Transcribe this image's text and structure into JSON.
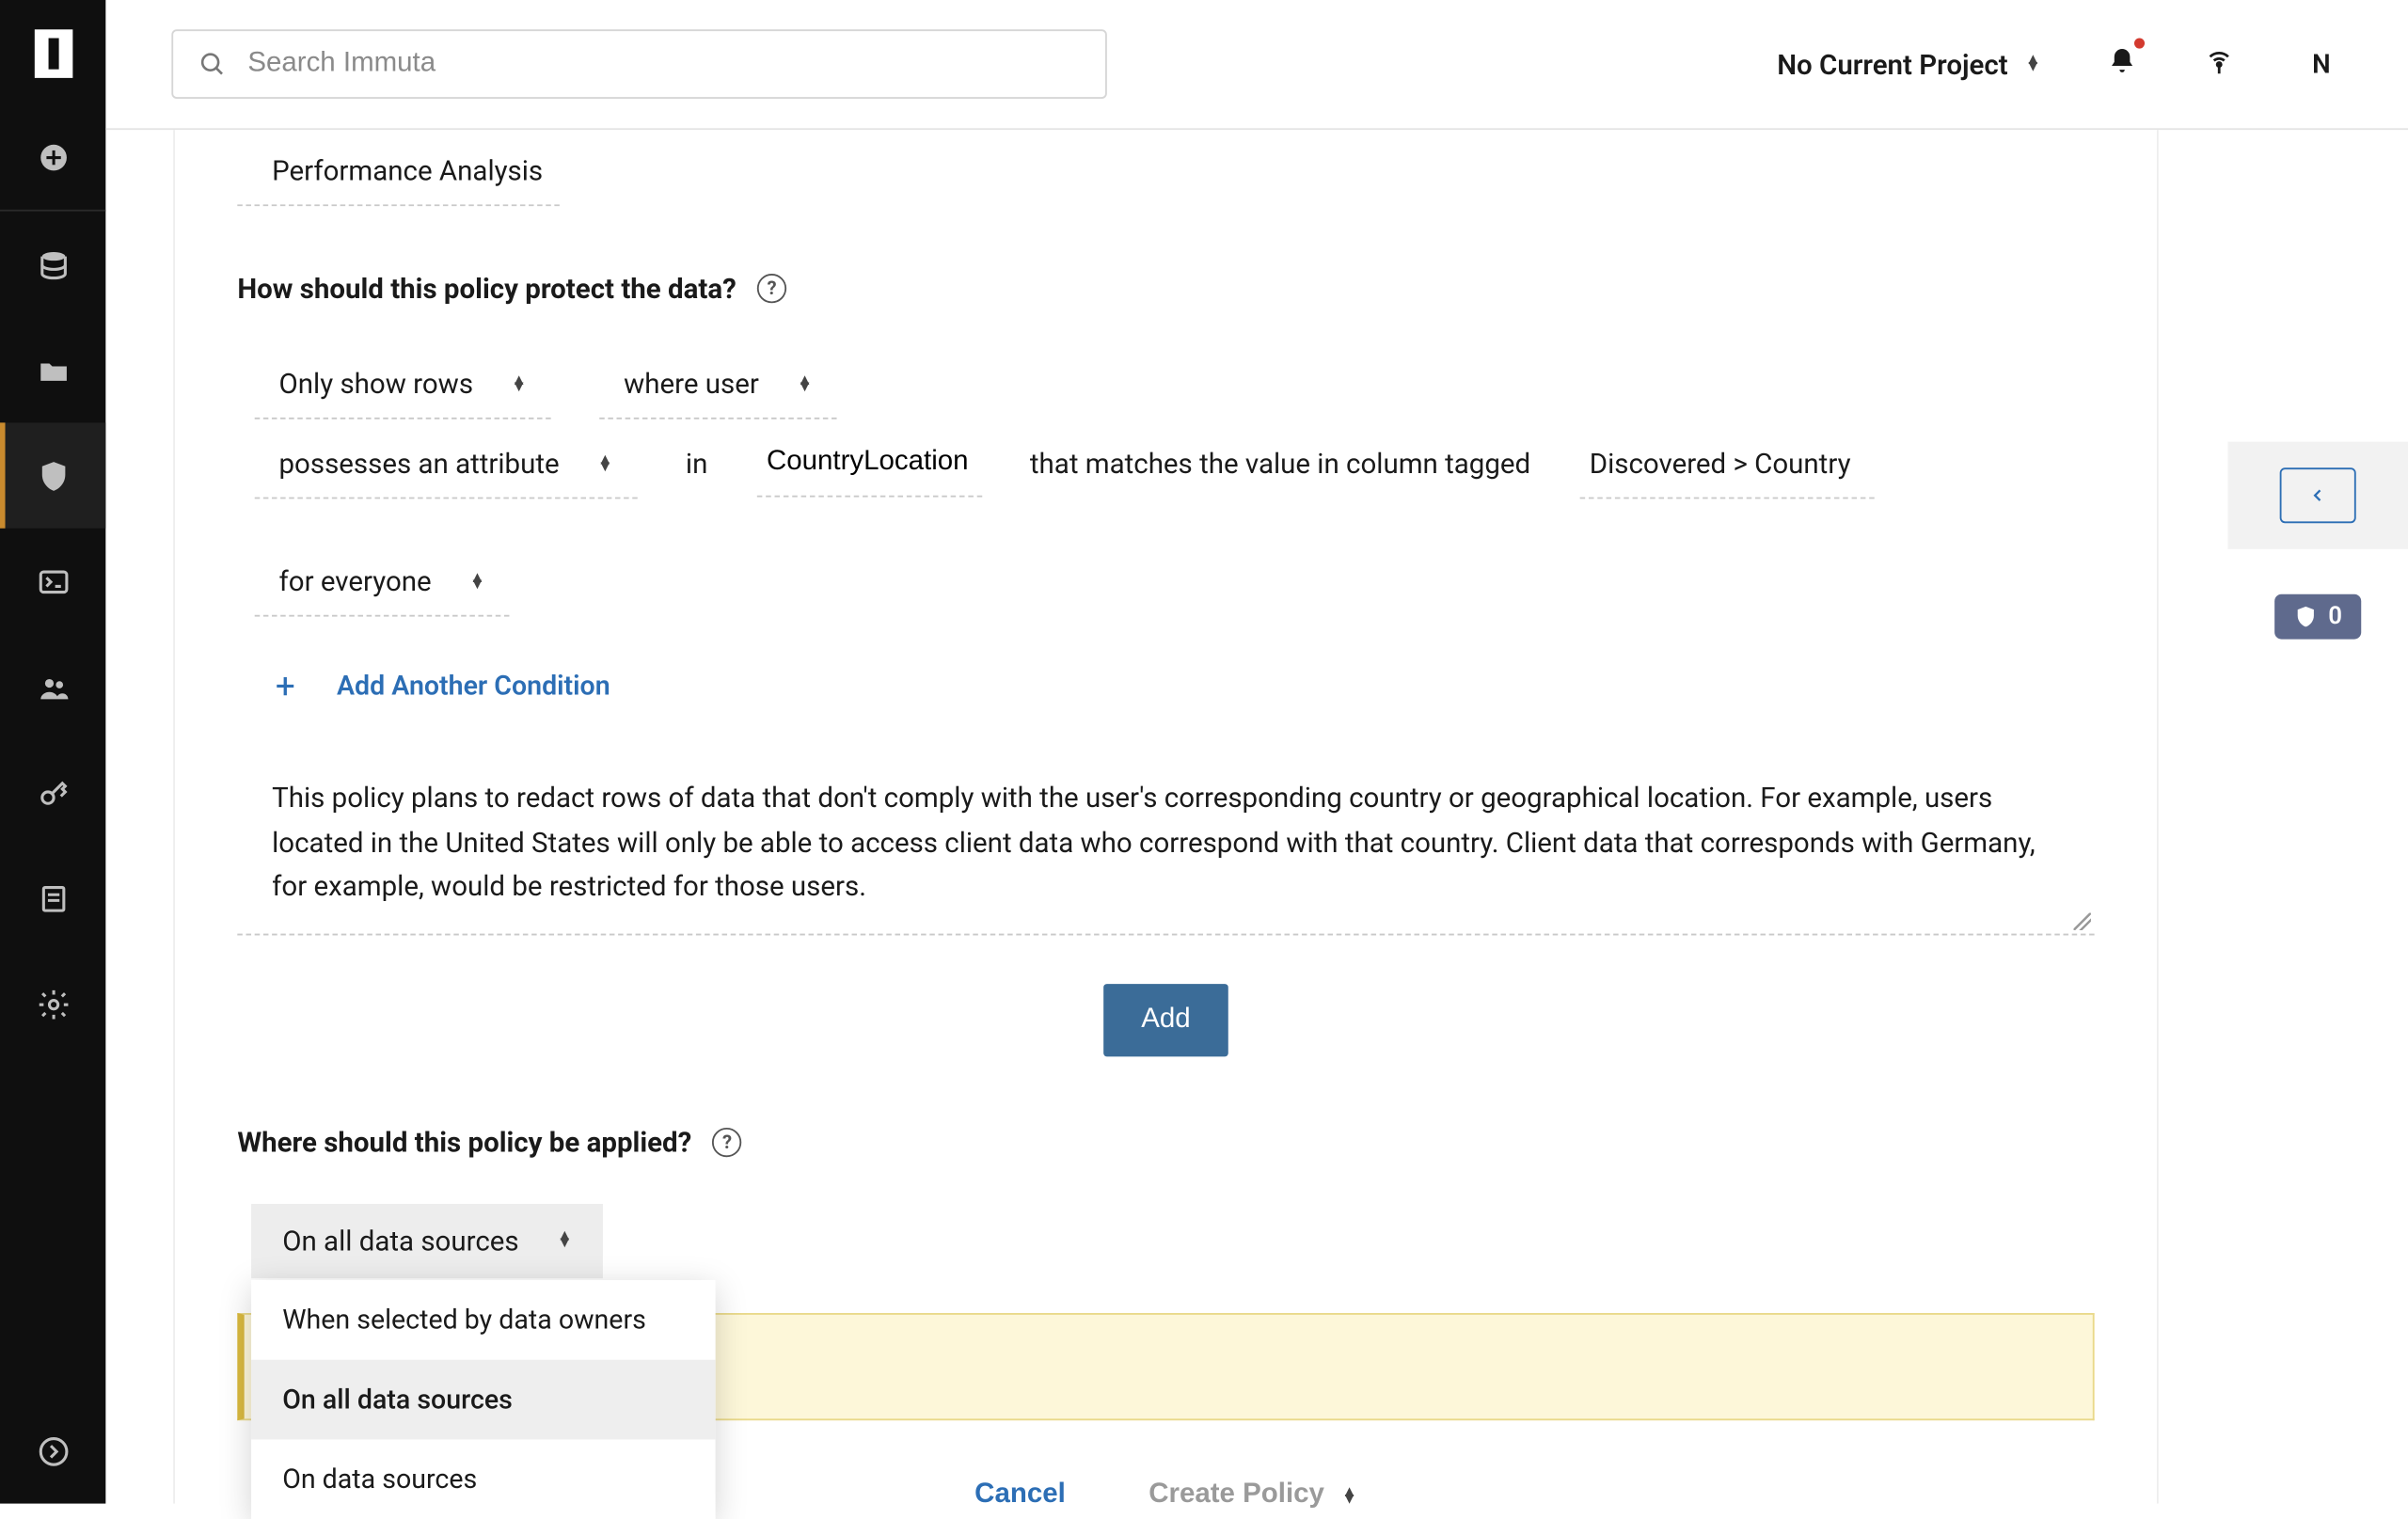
{
  "search": {
    "placeholder": "Search Immuta"
  },
  "header": {
    "project_label": "No Current Project",
    "avatar_initial": "N"
  },
  "policy": {
    "name": "Performance Analysis",
    "protect_heading": "How should this policy protect the data?",
    "rule": {
      "show_rows": "Only show rows",
      "where_user": "where user",
      "possesses": "possesses an attribute",
      "in": "in",
      "attr_name": "CountryLocation",
      "matches": "that matches the value in column tagged",
      "tag_value": "Discovered > Country",
      "scope": "for everyone"
    },
    "add_condition": "Add Another Condition",
    "description": "This policy plans to redact rows of data that don't comply with the user's corresponding country or geographical location. For example, users located in the United States will only be able to access client data who correspond with that country. Client data that corresponds with Germany, for example, would be restricted for those users.",
    "add_button": "Add",
    "where_heading": "Where should this policy be applied?",
    "scope_selected": "On all data sources",
    "scope_options": [
      "When selected by data owners",
      "On all data sources",
      "On data sources"
    ],
    "cancel": "Cancel",
    "create": "Create Policy"
  },
  "right": {
    "badge_count": "0"
  }
}
